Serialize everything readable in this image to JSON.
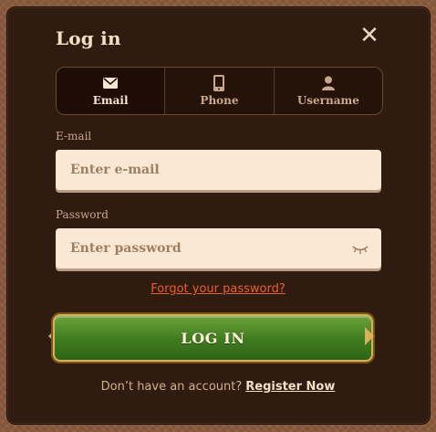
{
  "modal": {
    "title": "Log in",
    "close_icon": "close-icon"
  },
  "tabs": [
    {
      "label": "Email",
      "icon": "envelope-icon",
      "active": true
    },
    {
      "label": "Phone",
      "icon": "phone-icon",
      "active": false
    },
    {
      "label": "Username",
      "icon": "user-icon",
      "active": false
    }
  ],
  "form": {
    "email_label": "E-mail",
    "email_placeholder": "Enter e-mail",
    "password_label": "Password",
    "password_placeholder": "Enter password",
    "password_toggle_icon": "eye-closed-icon",
    "forgot_text": "Forgot your password?",
    "login_label": "LOG IN"
  },
  "footer": {
    "prompt": "Don’t have an account?",
    "register_label": "Register Now"
  },
  "colors": {
    "modal_bg": "#2f1b10",
    "accent_link": "#e8602c",
    "button_green": "#3f7a1f",
    "button_border": "#d8b25a",
    "input_bg": "#fae8d4"
  }
}
